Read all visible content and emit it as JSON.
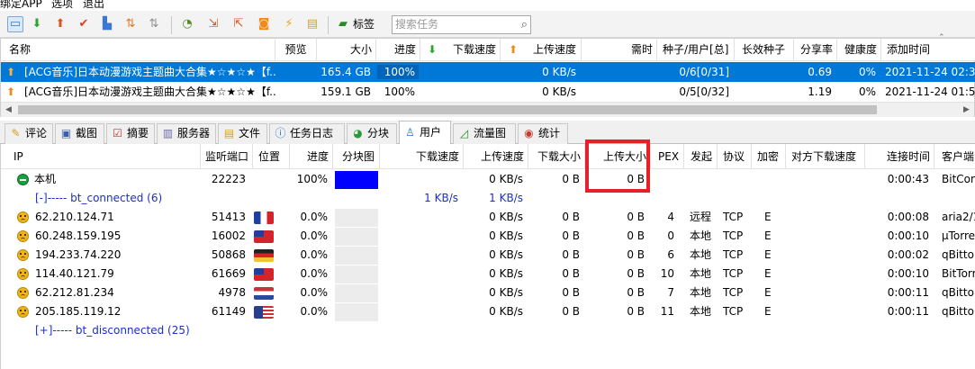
{
  "menubar": {
    "items": [
      "绑定APP",
      "选项",
      "退出"
    ]
  },
  "toolbar": {
    "icons": [
      "new-torrent-icon",
      "download-icon",
      "upload-icon",
      "check-icon",
      "file-icon",
      "priority-up-icon",
      "priority-down-icon",
      "speed-limit-icon",
      "import-icon",
      "export-icon",
      "rss-icon",
      "plugin-icon",
      "notes-icon"
    ],
    "tag_label": "标签",
    "search_placeholder": "搜索任务"
  },
  "torrent_table": {
    "headers": [
      "名称",
      "预览",
      "大小",
      "进度",
      "下载速度",
      "上传速度",
      "需时",
      "种子/用户[总]",
      "长效种子",
      "分享率",
      "健康度",
      "添加时间"
    ],
    "rows": [
      {
        "name": "[ACG音乐]日本动漫游戏主题曲大合集★☆★☆★【f...",
        "preview": "",
        "size": "165.4 GB",
        "progress": "100%",
        "progress_fraction": 1.0,
        "down_speed": "",
        "up_speed": "0 KB/s",
        "eta": "",
        "seeds_peers": "0/6[0/31]",
        "long_seed": "",
        "ratio": "0.69",
        "health": "0%",
        "added": "2021-11-24 02:3",
        "selected": true
      },
      {
        "name": "[ACG音乐]日本动漫游戏主题曲大合集★☆★☆★【f...",
        "preview": "",
        "size": "159.1 GB",
        "progress": "100%",
        "progress_fraction": 1.0,
        "down_speed": "",
        "up_speed": "0 KB/s",
        "eta": "",
        "seeds_peers": "0/5[0/32]",
        "long_seed": "",
        "ratio": "1.19",
        "health": "0%",
        "added": "2021-11-24 01:5",
        "selected": false
      }
    ]
  },
  "tabs": [
    {
      "label": "评论",
      "icon": "comment-icon"
    },
    {
      "label": "截图",
      "icon": "screenshot-icon"
    },
    {
      "label": "摘要",
      "icon": "summary-icon"
    },
    {
      "label": "服务器",
      "icon": "server-icon"
    },
    {
      "label": "文件",
      "icon": "file-icon"
    },
    {
      "label": "任务日志",
      "icon": "info-icon"
    },
    {
      "label": "分块",
      "icon": "pie-icon"
    },
    {
      "label": "用户",
      "icon": "user-icon",
      "active": true
    },
    {
      "label": "流量图",
      "icon": "chart-icon"
    },
    {
      "label": "统计",
      "icon": "stats-icon"
    }
  ],
  "peer_table": {
    "headers": [
      "IP",
      "监听端口",
      "位置",
      "进度",
      "分块图",
      "下载速度",
      "上传速度",
      "下载大小",
      "上传大小",
      "PEX",
      "发起",
      "协议",
      "加密",
      "对方下载速度",
      "连接时间",
      "客户端"
    ],
    "local": {
      "ip": "本机",
      "port": "22223",
      "progress": "100%",
      "progress_fraction": 1.0,
      "down_speed": "",
      "up_speed": "0 KB/s",
      "downloaded": "0 B",
      "uploaded": "0 B",
      "connect_time": "0:00:43",
      "client": "BitCon"
    },
    "connected_group": {
      "label": "[-]----- bt_connected (6)",
      "down_speed": "1 KB/s",
      "up_speed": "1 KB/s"
    },
    "peers": [
      {
        "ip": "62.210.124.71",
        "port": "51413",
        "flag": "fr",
        "progress": "0.0%",
        "up_speed": "0 KB/s",
        "downloaded": "0 B",
        "uploaded": "0 B",
        "pex": "4",
        "initiator": "远程",
        "protocol": "TCP",
        "encryption": "E",
        "connect_time": "0:00:08",
        "client": "aria2/1"
      },
      {
        "ip": "60.248.159.195",
        "port": "16002",
        "flag": "tw",
        "progress": "0.0%",
        "up_speed": "0 KB/s",
        "downloaded": "0 B",
        "uploaded": "0 B",
        "pex": "0",
        "initiator": "本地",
        "protocol": "TCP",
        "encryption": "E",
        "connect_time": "0:00:10",
        "client": "µTorre"
      },
      {
        "ip": "194.233.74.220",
        "port": "50868",
        "flag": "de",
        "progress": "0.0%",
        "up_speed": "0 KB/s",
        "downloaded": "0 B",
        "uploaded": "0 B",
        "pex": "6",
        "initiator": "本地",
        "protocol": "TCP",
        "encryption": "E",
        "connect_time": "0:00:02",
        "client": "qBitto"
      },
      {
        "ip": "114.40.121.79",
        "port": "61669",
        "flag": "tw",
        "progress": "0.0%",
        "up_speed": "0 KB/s",
        "downloaded": "0 B",
        "uploaded": "0 B",
        "pex": "10",
        "initiator": "本地",
        "protocol": "TCP",
        "encryption": "E",
        "connect_time": "0:00:10",
        "client": "BitTorr"
      },
      {
        "ip": "62.212.81.234",
        "port": "4978",
        "flag": "nl",
        "progress": "0.0%",
        "up_speed": "0 KB/s",
        "downloaded": "0 B",
        "uploaded": "0 B",
        "pex": "7",
        "initiator": "本地",
        "protocol": "TCP",
        "encryption": "E",
        "connect_time": "0:00:11",
        "client": "qBitto"
      },
      {
        "ip": "205.185.119.12",
        "port": "61149",
        "flag": "us",
        "progress": "0.0%",
        "up_speed": "0 KB/s",
        "downloaded": "0 B",
        "uploaded": "0 B",
        "pex": "11",
        "initiator": "本地",
        "protocol": "TCP",
        "encryption": "E",
        "connect_time": "0:00:11",
        "client": "qBitto"
      }
    ],
    "disconnected_group": {
      "label": "[+]----- bt_disconnected (25)"
    }
  },
  "colors": {
    "selection": "#0078d7",
    "progress_fill": "#0000ff",
    "highlight": "#e5202a",
    "link_blue": "#1c2fc8"
  }
}
